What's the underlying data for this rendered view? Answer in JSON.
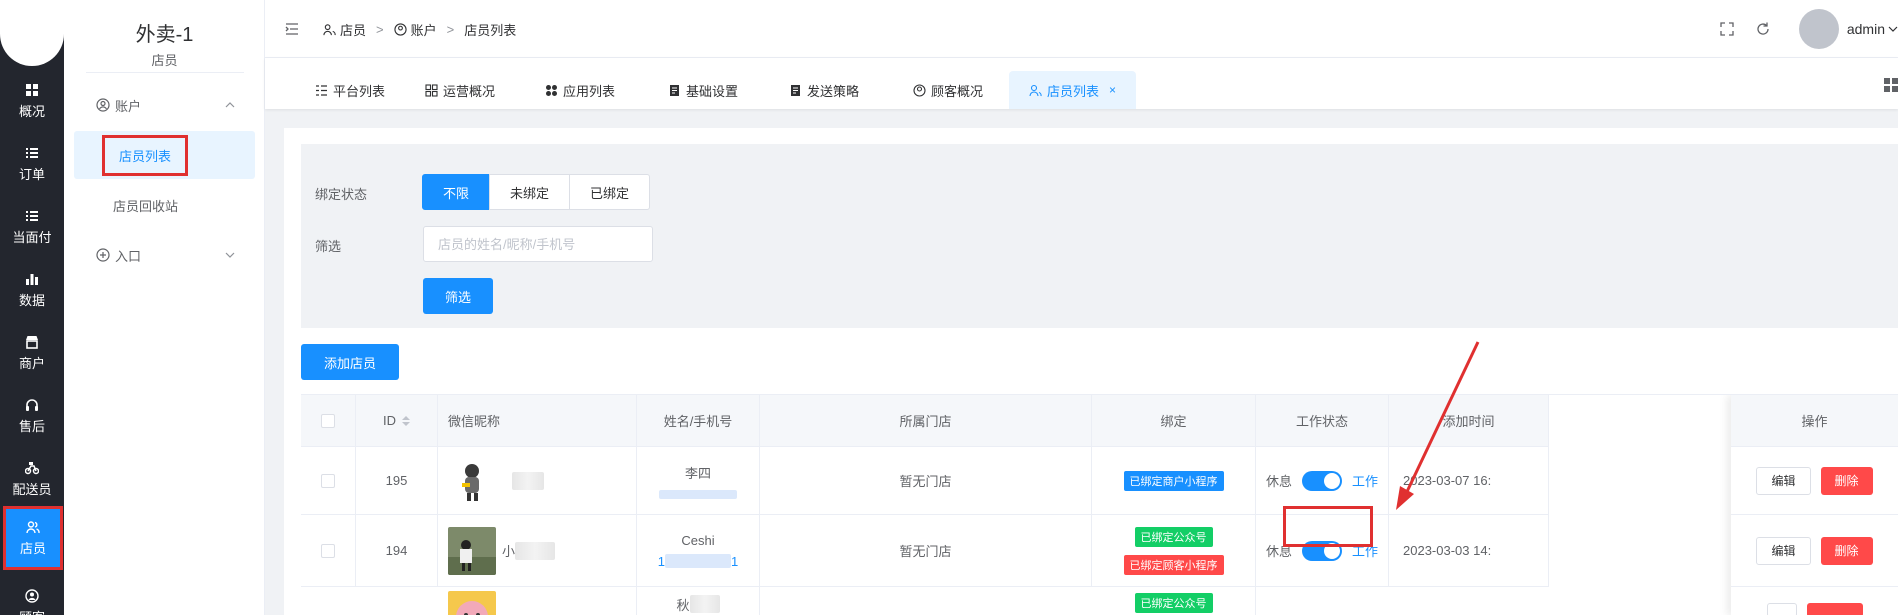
{
  "rail": {
    "items": [
      {
        "label": "概况",
        "icon": "grid-icon"
      },
      {
        "label": "订单",
        "icon": "list-icon"
      },
      {
        "label": "当面付",
        "icon": "list-icon"
      },
      {
        "label": "数据",
        "icon": "bar-chart-icon"
      },
      {
        "label": "商户",
        "icon": "shop-icon"
      },
      {
        "label": "售后",
        "icon": "headset-icon"
      },
      {
        "label": "配送员",
        "icon": "motorbike-icon"
      },
      {
        "label": "店员",
        "icon": "users-icon"
      },
      {
        "label": "顾客",
        "icon": "user-circle-icon"
      }
    ]
  },
  "subside": {
    "store_name": "外卖-1",
    "role": "店员",
    "group_account": "账户",
    "items": [
      "店员列表",
      "店员回收站"
    ],
    "group_entry": "入口"
  },
  "header": {
    "breadcrumb": [
      "店员",
      "账户",
      "店员列表"
    ],
    "user": "admin"
  },
  "tabs": [
    {
      "label": "平台列表"
    },
    {
      "label": "运营概况"
    },
    {
      "label": "应用列表"
    },
    {
      "label": "基础设置"
    },
    {
      "label": "发送策略"
    },
    {
      "label": "顾客概况"
    },
    {
      "label": "店员列表",
      "close": "×"
    }
  ],
  "filter": {
    "bind_label": "绑定状态",
    "bind_options": [
      "不限",
      "未绑定",
      "已绑定"
    ],
    "search_label": "筛选",
    "search_placeholder": "店员的姓名/昵称/手机号",
    "search_button": "筛选"
  },
  "add_button": "添加店员",
  "table": {
    "columns": [
      "ID",
      "微信昵称",
      "姓名/手机号",
      "所属门店",
      "绑定",
      "工作状态",
      "添加时间",
      "操作"
    ],
    "rows": [
      {
        "id": "195",
        "nickname": "",
        "name": "李四",
        "phone": "",
        "store": "暂无门店",
        "bind": [
          "已绑定商户小程序"
        ],
        "rest": "休息",
        "work": "工作",
        "added": "2023-03-07 16:",
        "edit": "编辑",
        "delete": "删除"
      },
      {
        "id": "194",
        "nickname": "小",
        "name": "Ceshi",
        "phone": "1",
        "phone_tail": "1",
        "store": "暂无门店",
        "bind": [
          "已绑定公众号",
          "已绑定顾客小程序"
        ],
        "rest": "休息",
        "work": "工作",
        "added": "2023-03-03 14:",
        "edit": "编辑",
        "delete": "删除"
      },
      {
        "id": "",
        "nickname": "",
        "name": "秋",
        "phone": "",
        "store": "",
        "bind": [
          "已绑定公众号"
        ],
        "rest": "",
        "work": "",
        "added": "",
        "edit": "",
        "delete": ""
      }
    ]
  },
  "colors": {
    "primary": "#1890ff",
    "danger": "#ff4949",
    "success": "#13ce66",
    "rail": "#23262e",
    "highlight": "#e03030"
  }
}
